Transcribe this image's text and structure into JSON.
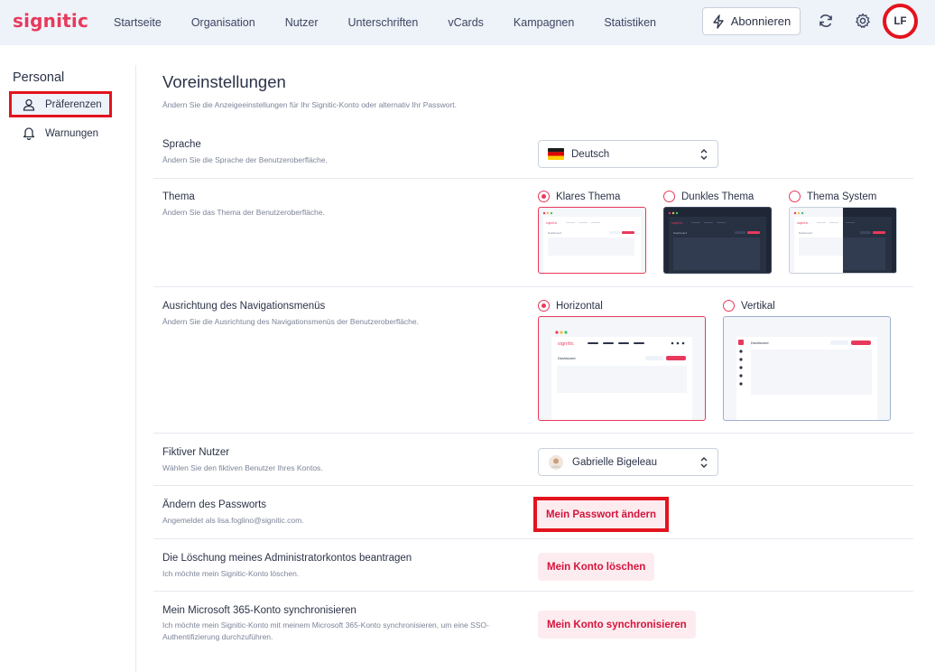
{
  "app": {
    "logo": "signitic"
  },
  "nav": {
    "items": [
      "Startseite",
      "Organisation",
      "Nutzer",
      "Unterschriften",
      "vCards",
      "Kampagnen",
      "Statistiken"
    ],
    "subscribe_label": "Abonnieren",
    "avatar_initials": "LF"
  },
  "sidebar": {
    "heading": "Personal",
    "items": [
      {
        "label": "Präferenzen",
        "icon": "user-icon",
        "active": true
      },
      {
        "label": "Warnungen",
        "icon": "bell-icon",
        "active": false
      }
    ]
  },
  "main": {
    "title": "Voreinstellungen",
    "subtitle": "Ändern Sie die Anzeigeeinstellungen für Ihr Signitic-Konto oder alternativ Ihr Passwort.",
    "language": {
      "title": "Sprache",
      "desc": "Ändern Sie die Sprache der Benutzeroberfläche.",
      "value": "Deutsch"
    },
    "theme": {
      "title": "Thema",
      "desc": "Ändern Sie das Thema der Benutzeroberfläche.",
      "options": [
        {
          "label": "Klares Thema",
          "checked": true
        },
        {
          "label": "Dunkles Thema",
          "checked": false
        },
        {
          "label": "Thema System",
          "checked": false
        }
      ],
      "preview_logo": "signitic",
      "preview_heading": "Dashboard"
    },
    "navigation": {
      "title": "Ausrichtung des Navigationsmenüs",
      "desc": "Ändern Sie die Ausrichtung des Navigationsmenüs der Benutzeroberfläche.",
      "options": [
        {
          "label": "Horizontal",
          "checked": true
        },
        {
          "label": "Vertikal",
          "checked": false
        }
      ],
      "preview_logo": "signitic",
      "preview_heading": "Dashboard"
    },
    "fictive_user": {
      "title": "Fiktiver Nutzer",
      "desc": "Wählen Sie den fiktiven Benutzer Ihres Kontos.",
      "value": "Gabrielle Bigeleau"
    },
    "password": {
      "title": "Ändern des Passworts",
      "desc": "Angemeldet als lisa.foglino@signitic.com.",
      "button": "Mein Passwort ändern"
    },
    "delete_account": {
      "title": "Die Löschung meines Administratorkontos beantragen",
      "desc": "Ich möchte mein Signitic-Konto löschen.",
      "button": "Mein Konto löschen"
    },
    "sync": {
      "title": "Mein Microsoft 365-Konto synchronisieren",
      "desc": "Ich möchte mein Signitic-Konto mit meinem Microsoft 365-Konto synchronisieren, um eine SSO-Authentifizierung durchzuführen.",
      "button": "Mein Konto synchronisieren"
    }
  },
  "colors": {
    "accent": "#e8395c",
    "highlight_box": "#e3131e",
    "topbar_bg": "#eef2f9",
    "dark_theme_bg": "#1f2737"
  }
}
